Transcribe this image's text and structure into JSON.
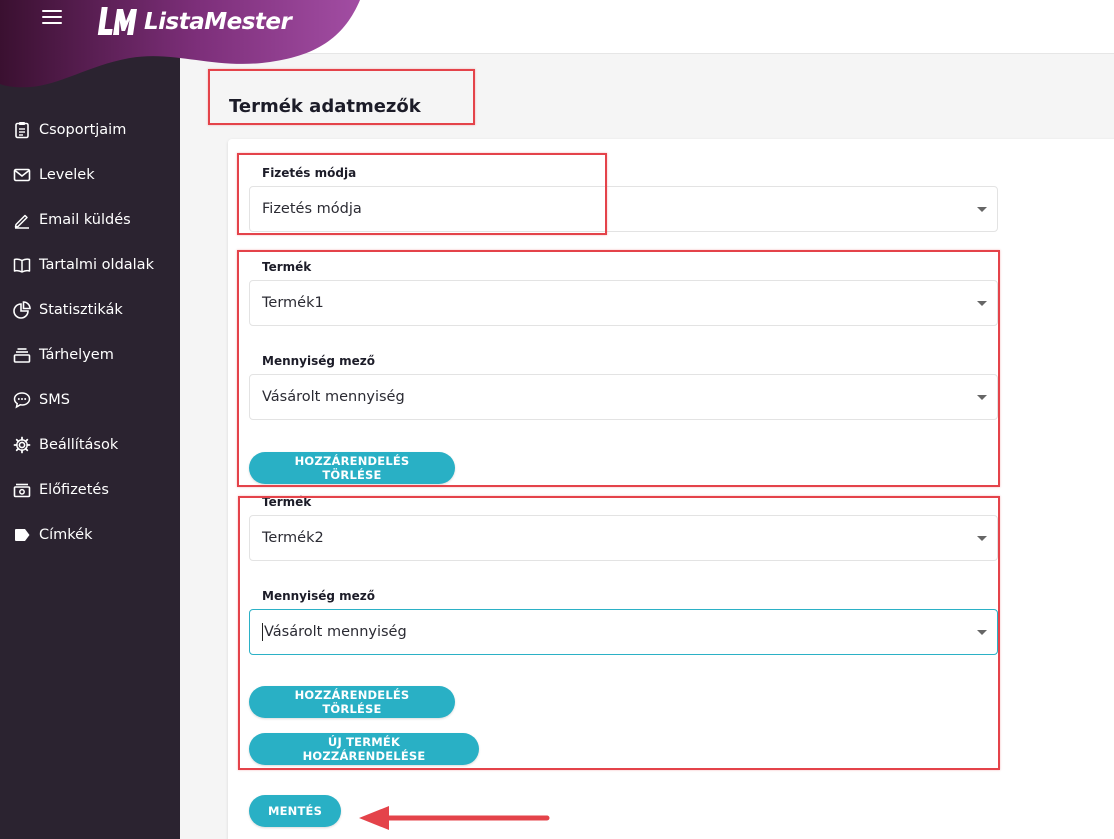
{
  "app": {
    "name": "ListaMester",
    "accent": "#29b0c5",
    "sidebar_bg": "#2b2330",
    "highlight": "#e4434a"
  },
  "sidebar": {
    "items": [
      {
        "label": "Csoportjaim",
        "icon": "clipboard-icon"
      },
      {
        "label": "Levelek",
        "icon": "mail-icon"
      },
      {
        "label": "Email küldés",
        "icon": "pencil-icon"
      },
      {
        "label": "Tartalmi oldalak",
        "icon": "book-icon"
      },
      {
        "label": "Statisztikák",
        "icon": "pie-chart-icon"
      },
      {
        "label": "Tárhelyem",
        "icon": "storage-icon"
      },
      {
        "label": "SMS",
        "icon": "chat-bubble-icon"
      },
      {
        "label": "Beállítások",
        "icon": "gear-icon"
      },
      {
        "label": "Előfizetés",
        "icon": "cash-icon"
      },
      {
        "label": "Címkék",
        "icon": "tag-icon"
      }
    ]
  },
  "main": {
    "title": "Termék adatmezők",
    "payment": {
      "label": "Fizetés módja",
      "value": "Fizetés módja"
    },
    "groups": [
      {
        "product_label": "Termék",
        "product_value": "Termék1",
        "quantity_label": "Mennyiség mező",
        "quantity_value": "Vásárolt mennyiség",
        "remove_label": "HOZZÁRENDELÉS TÖRLÉSE"
      },
      {
        "product_label": "Termék",
        "product_value": "Termék2",
        "quantity_label": "Mennyiség mező",
        "quantity_value": "Vásárolt mennyiség",
        "remove_label": "HOZZÁRENDELÉS TÖRLÉSE"
      }
    ],
    "add_product_label": "ÚJ TERMÉK HOZZÁRENDELÉSE",
    "save_label": "MENTÉS"
  }
}
